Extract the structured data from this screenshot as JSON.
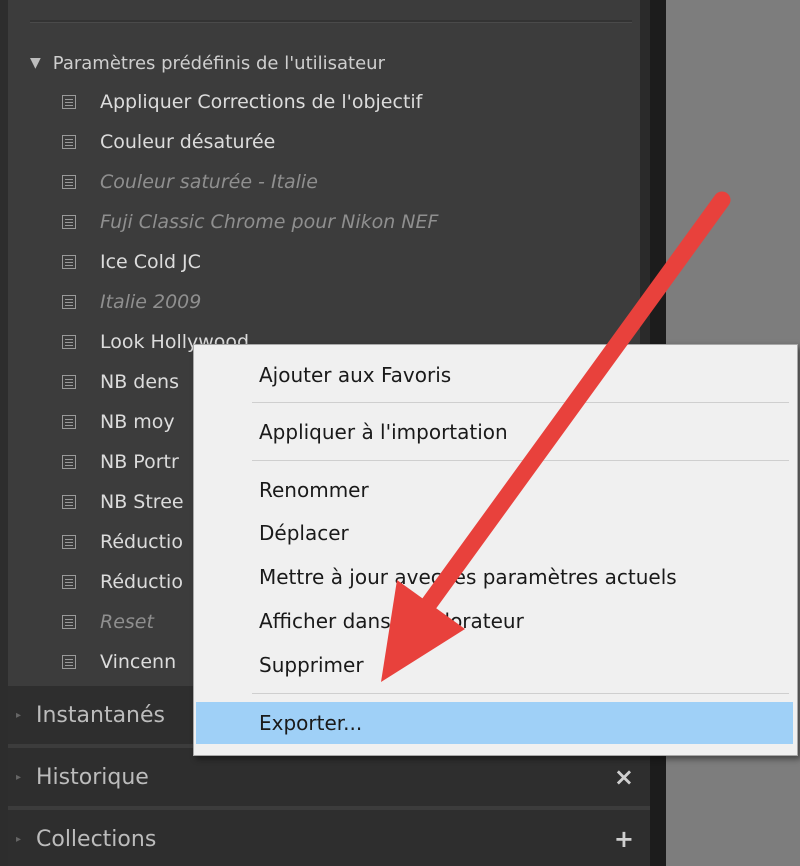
{
  "panel": {
    "folder_label": "Paramètres prédéfinis de l'utilisateur",
    "presets": [
      {
        "label": "Appliquer Corrections de l'objectif",
        "italic": false
      },
      {
        "label": "Couleur désaturée",
        "italic": false
      },
      {
        "label": "Couleur saturée - Italie",
        "italic": true
      },
      {
        "label": "Fuji Classic Chrome pour Nikon NEF",
        "italic": true
      },
      {
        "label": "Ice Cold JC",
        "italic": false
      },
      {
        "label": "Italie 2009",
        "italic": true
      },
      {
        "label": "Look Hollywood",
        "italic": false
      },
      {
        "label": "NB dens",
        "italic": false
      },
      {
        "label": "NB moy",
        "italic": false
      },
      {
        "label": "NB Portr",
        "italic": false
      },
      {
        "label": "NB Stree",
        "italic": false
      },
      {
        "label": "Réductio",
        "italic": false
      },
      {
        "label": "Réductio",
        "italic": false
      },
      {
        "label": "Reset",
        "italic": true
      },
      {
        "label": "Vincenn",
        "italic": false
      }
    ],
    "sections": {
      "snapshots": "Instantanés",
      "history": "Historique",
      "history_action": "×",
      "collections": "Collections",
      "collections_action": "+"
    }
  },
  "context_menu": {
    "items": [
      "Ajouter aux Favoris",
      "Appliquer à l'importation",
      "Renommer",
      "Déplacer",
      "Mettre à jour avec les paramètres actuels",
      "Afficher dans l'explorateur",
      "Supprimer",
      "Exporter..."
    ],
    "highlighted": "Exporter..."
  },
  "colors": {
    "panel_bg": "#3c3c3c",
    "menu_bg": "#f0f0f0",
    "highlight": "#9fd0f7",
    "arrow": "#e8413c"
  }
}
